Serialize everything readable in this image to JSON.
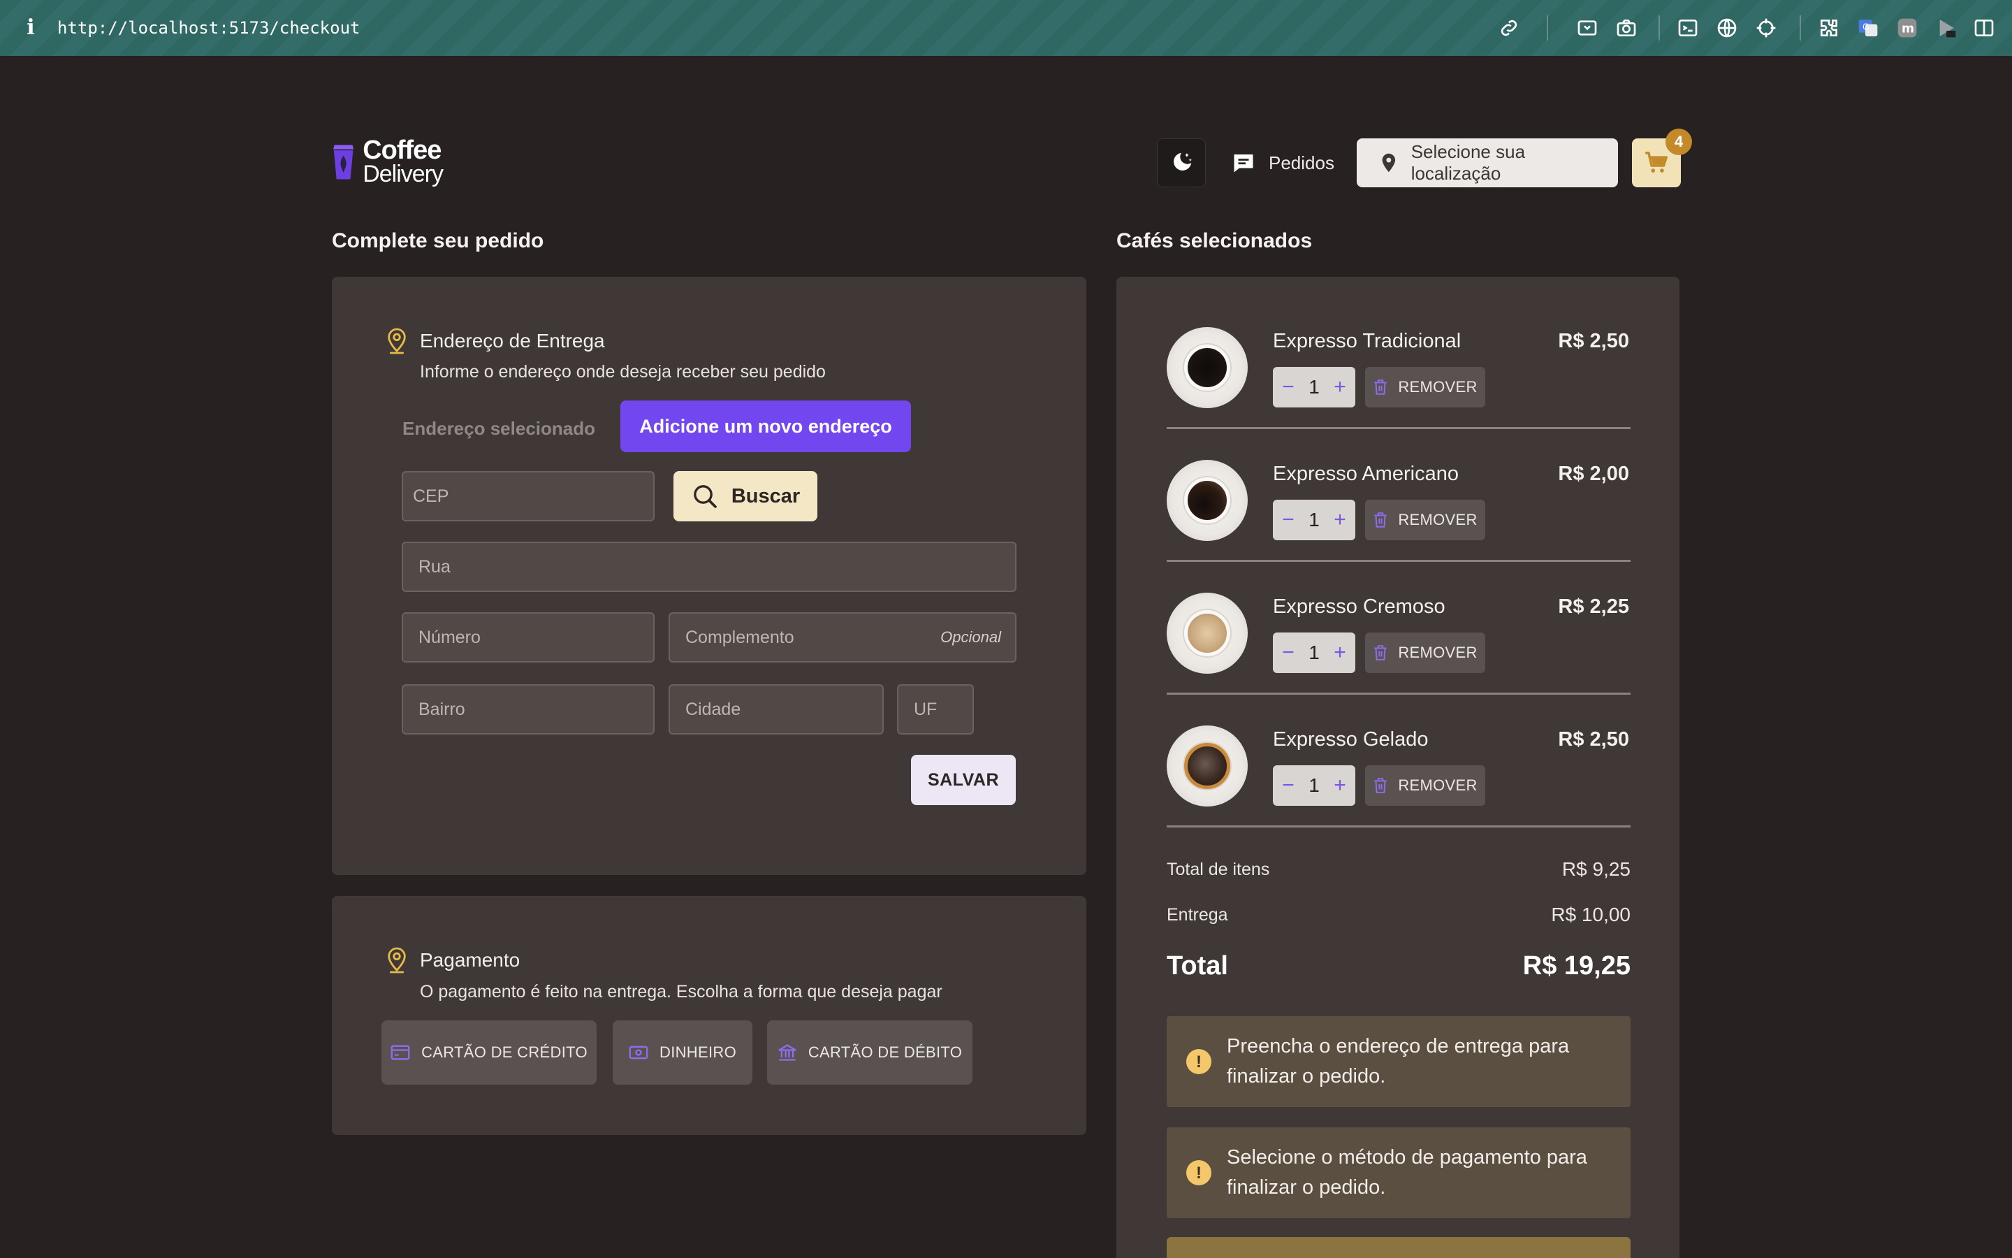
{
  "browser": {
    "url": "http://localhost:5173/checkout",
    "info_icon": "i"
  },
  "header": {
    "logo_line1": "Coffee",
    "logo_line2": "Delivery",
    "orders_label": "Pedidos",
    "location_label": "Selecione sua localização",
    "cart_count": "4"
  },
  "checkout": {
    "title": "Complete seu pedido",
    "address": {
      "title": "Endereço de Entrega",
      "subtitle": "Informe o endereço onde deseja receber seu pedido",
      "tab_selected": "Endereço selecionado",
      "tab_new": "Adicione um novo endereço",
      "cep_placeholder": "CEP",
      "search_label": "Buscar",
      "rua_placeholder": "Rua",
      "numero_placeholder": "Número",
      "complemento_placeholder": "Complemento",
      "optional_label": "Opcional",
      "bairro_placeholder": "Bairro",
      "cidade_placeholder": "Cidade",
      "uf_placeholder": "UF",
      "save_label": "SALVAR"
    },
    "payment": {
      "title": "Pagamento",
      "subtitle": "O pagamento é feito na entrega. Escolha a forma que deseja pagar",
      "options": [
        "CARTÃO DE CRÉDITO",
        "DINHEIRO",
        "CARTÃO DE DÉBITO"
      ]
    }
  },
  "cart": {
    "title": "Cafés selecionados",
    "remove_label": "REMOVER",
    "items": [
      {
        "name": "Expresso Tradicional",
        "price": "R$ 2,50",
        "qty": "1"
      },
      {
        "name": "Expresso Americano",
        "price": "R$ 2,00",
        "qty": "1"
      },
      {
        "name": "Expresso Cremoso",
        "price": "R$ 2,25",
        "qty": "1"
      },
      {
        "name": "Expresso Gelado",
        "price": "R$ 2,50",
        "qty": "1"
      }
    ],
    "items_total_label": "Total de itens",
    "items_total_value": "R$ 9,25",
    "delivery_label": "Entrega",
    "delivery_value": "R$ 10,00",
    "total_label": "Total",
    "total_value": "R$ 19,25",
    "alerts": [
      "Preencha o endereço de entrega para finalizar o pedido.",
      "Selecione o método de pagamento para finalizar o pedido."
    ]
  },
  "colors": {
    "background": "#272221",
    "card": "#3f3836",
    "accent_purple": "#7347f0",
    "accent_yellow": "#f1e2b8",
    "badge": "#c48a2a"
  }
}
